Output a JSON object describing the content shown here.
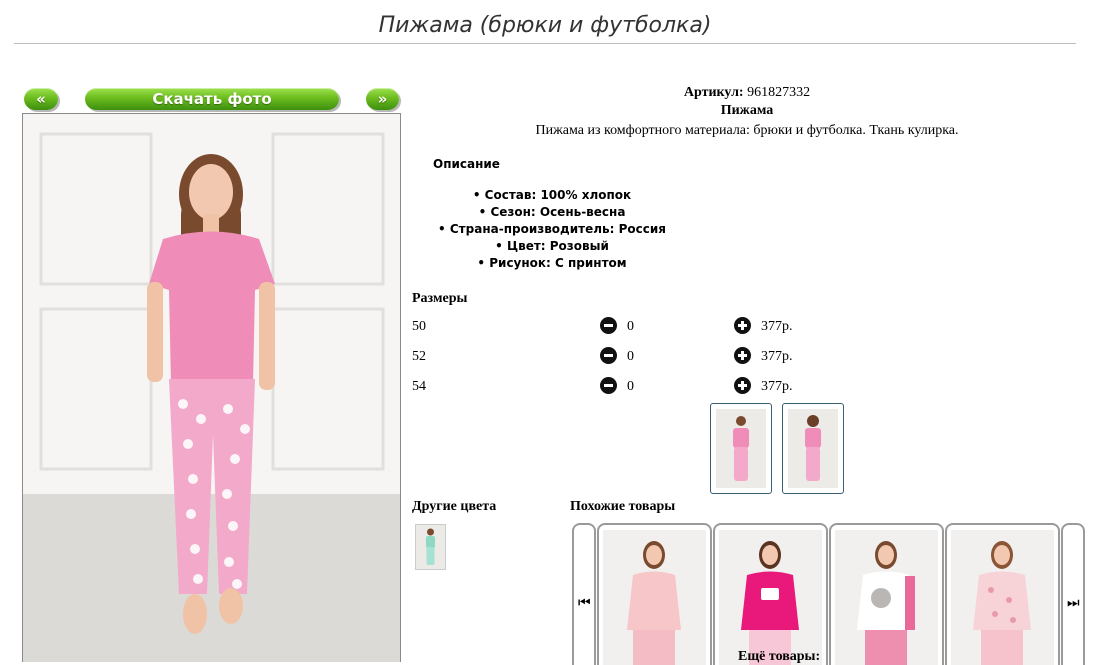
{
  "page": {
    "title": "Пижама (брюки и футболка)"
  },
  "nav": {
    "prev_label": "«",
    "next_label": "»",
    "download_label": "Скачать фото"
  },
  "product": {
    "article_label": "Артикул:",
    "article_value": "961827332",
    "name": "Пижама",
    "short_description": "Пижама из комфортного материала: брюки и футболка. Ткань кулирка.",
    "description_heading": "Описание",
    "properties": [
      "Состав: 100% хлопок",
      "Сезон: Осень-весна",
      "Страна-производитель: Россия",
      "Цвет: Розовый",
      "Рисунок: С принтом"
    ],
    "colors": {
      "top": "#f08cb8",
      "pants": "#f3a9c9",
      "accent_green": "#6cbc1e"
    }
  },
  "sizes": {
    "heading": "Размеры",
    "rows": [
      {
        "size": "50",
        "qty": "0",
        "price": "377р."
      },
      {
        "size": "52",
        "qty": "0",
        "price": "377р."
      },
      {
        "size": "54",
        "qty": "0",
        "price": "377р."
      }
    ],
    "icons": {
      "decrease": "minus-circle-icon",
      "increase": "plus-circle-icon"
    }
  },
  "other_colors": {
    "heading": "Другие цвета"
  },
  "similar": {
    "heading": "Похожие товары",
    "more_label": "Ещё товары:",
    "prev_icon": "skip-back-icon",
    "next_icon": "skip-forward-icon",
    "prev_glyph": "⏮",
    "next_glyph": "⏭"
  }
}
